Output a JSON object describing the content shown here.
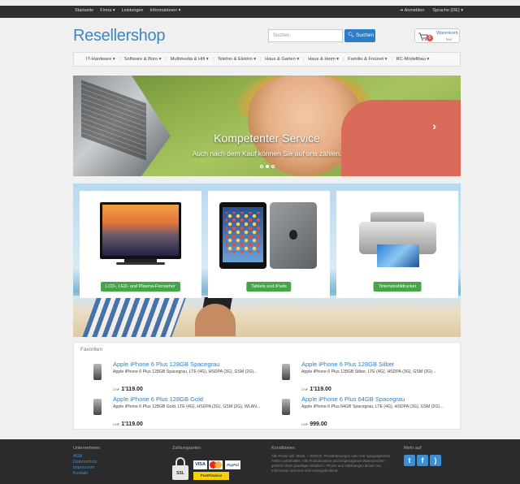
{
  "topbar": {
    "links": [
      "Startseite",
      "Firma ▾",
      "Leistungen",
      "Informationen ▾"
    ],
    "login": "➜ Anmelden",
    "language": "Sprache (DE) ▾"
  },
  "header": {
    "logo_part1": "Reseller",
    "logo_part2": "shop",
    "search_placeholder": "Suchen",
    "search_button": "Suchen",
    "cart_label": "Warenkorb",
    "cart_status": "leer",
    "cart_count": "0"
  },
  "nav": {
    "items": [
      "IT-Hardware ▾",
      "Software & Büro ▾",
      "Multimedia & Hifi ▾",
      "Telefon & Elektro ▾",
      "Haus & Garten ▾",
      "Haus & Heim ▾",
      "Familie & Freizeit ▾",
      "RC-Modellbau ▾"
    ]
  },
  "hero": {
    "title": "Kompetenter Service",
    "subtitle": "Auch nach dem Kauf können Sie auf uns zählen.",
    "next_arrow": "›"
  },
  "categories": [
    {
      "label": "LCD-, LED- und Plasma-Fernseher"
    },
    {
      "label": "Tablets und iPads"
    },
    {
      "label": "Tintenstrahldrucker"
    }
  ],
  "favorites": {
    "heading": "Favoriten",
    "products": [
      {
        "title": "Apple iPhone 6 Plus 128GB Spacegrau",
        "desc": "Apple iPhone 6 Plus 128GB Spacegrau, LTE (4G), HSDPA (3G), GSM (2G)...",
        "currency": "CHF",
        "price": "1'119.00"
      },
      {
        "title": "Apple iPhone 6 Plus 128GB Silber",
        "desc": "Apple iPhone 6 Plus 128GB Silber, LTE (4G), HSDPA (3G), GSM (2G)...",
        "currency": "CHF",
        "price": "1'119.00"
      },
      {
        "title": "Apple iPhone 6 Plus 128GB Gold",
        "desc": "Apple iPhone 6 Plus 128GB Gold, LTE (4G), HSDPA (3G), GSM (2G), WLAN...",
        "currency": "CHF",
        "price": "1'119.00"
      },
      {
        "title": "Apple iPhone 6 Plus 64GB Spacegrau",
        "desc": "Apple iPhone 6 Plus 64GB Spacegrau, LTE (4G), HSDPA (3G), GSM (2G)...",
        "currency": "CHF",
        "price": "999.00"
      }
    ]
  },
  "footer": {
    "col1_title": "Unternehmen",
    "col1_links": [
      "AGB",
      "Datenschutz",
      "Impressum",
      "Kontakt"
    ],
    "col2_title": "Zahlungsarten",
    "payment": {
      "ssl": "SSL",
      "visa": "VISA",
      "paypal": "PayPal",
      "postfinance": "PostFinance"
    },
    "col3_title": "Konditionen",
    "col3_text": "Alle Preise inkl. MwSt. + SWICO. Preisänderungen oder evtl. typographische Fehler vorbehalten. Alle Produktnamen und eingetragenen Warenzeichen gehören ihren jeweiligen Inhabern. Photos und Abbildungen dienen zur Information und sind nicht vertragsbindend.",
    "col4_title": "Mehr auf",
    "social": [
      "twitter-icon",
      "facebook-icon",
      "rss-icon"
    ]
  },
  "colors": {
    "accent": "#2e7ec7",
    "button_green": "#48a448",
    "footer_bg": "#2b2b2b"
  }
}
